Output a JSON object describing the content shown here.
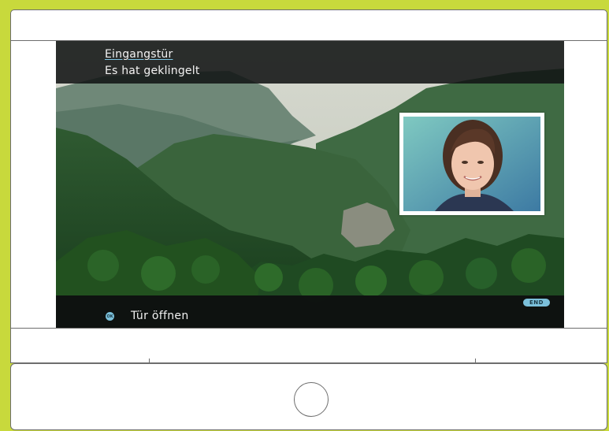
{
  "notification": {
    "title": "Eingangstür",
    "subtitle": "Es hat geklingelt"
  },
  "actions": {
    "ok_icon_label": "OK",
    "open_door_label": "Tür öffnen",
    "end_label": "END"
  },
  "colors": {
    "background": "#c8d93c",
    "accent": "#7bc0da",
    "bar": "#121515",
    "text": "#f2f2f2"
  },
  "icons": {
    "ok": "ok-button-icon",
    "end": "end-button-badge"
  }
}
